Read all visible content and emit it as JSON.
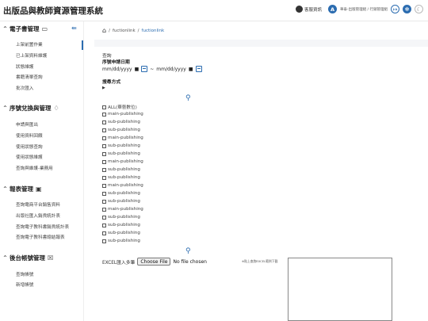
{
  "app": {
    "title": "出版品與教師資源管理系統"
  },
  "topbar": {
    "service_label": "客服資訊",
    "avatar_letter": "A",
    "user_info": "華泰-出版管理組 / 行銷管理組",
    "icons": [
      "service-icon",
      "logout-icon",
      "gear-icon",
      "moon-icon"
    ]
  },
  "sidebar": {
    "sections": [
      {
        "title": "電子書管理",
        "icon": "book-icon",
        "items": [
          "上架前置作業",
          "已上架資料維護",
          "狀態維護",
          "書籍清單查詢",
          "批次匯入"
        ]
      },
      {
        "title": "序號兌換與管理",
        "icon": "ticket-icon",
        "items": [
          "申請與匯出",
          "使用資料回饋",
          "使用狀態查詢",
          "使用狀態維護",
          "查詢與維護-業務用"
        ]
      },
      {
        "title": "報表管理",
        "icon": "report-icon",
        "items": [
          "查詢電商平台銷售資料",
          "出版社匯入銷貨統計表",
          "查詢電子教科書銷貨統計表",
          "查詢電子教科書總結報表"
        ]
      },
      {
        "title": "後台帳號管理",
        "icon": "account-icon",
        "items": [
          "查詢帳號",
          "新增帳號"
        ]
      }
    ]
  },
  "breadcrumb": {
    "root": "fuctionlink",
    "separator": "/",
    "current": "fuctionlink"
  },
  "form": {
    "query_label": "查詢",
    "date_label": "序號申請日期",
    "date_start_placeholder": "mm/dd/yyyy",
    "date_sep": "~",
    "date_end_placeholder": "mm/dd/yyyy",
    "method_label": "搜尋方式",
    "checkboxes": [
      "ALL(華藝數位)",
      "main-publishing",
      "sub-publishing",
      "sub-publishing",
      "main-publishing",
      "sub-publishing",
      "sub-publishing",
      "main-publishing",
      "sub-publishing",
      "sub-publishing",
      "main-publishing",
      "sub-publishing",
      "sub-publishing",
      "main-publishing",
      "sub-publishing",
      "sub-publishing",
      "sub-publishing",
      "sub-publishing"
    ],
    "excel_label": "EXCEL匯入多筆",
    "file_button": "Choose File",
    "file_status": "No file chosen",
    "excel_hint": "※貼上查詢EXCEL範例下載"
  },
  "colors": {
    "accent": "#2b6cb0",
    "background": "#f5f6f8"
  }
}
